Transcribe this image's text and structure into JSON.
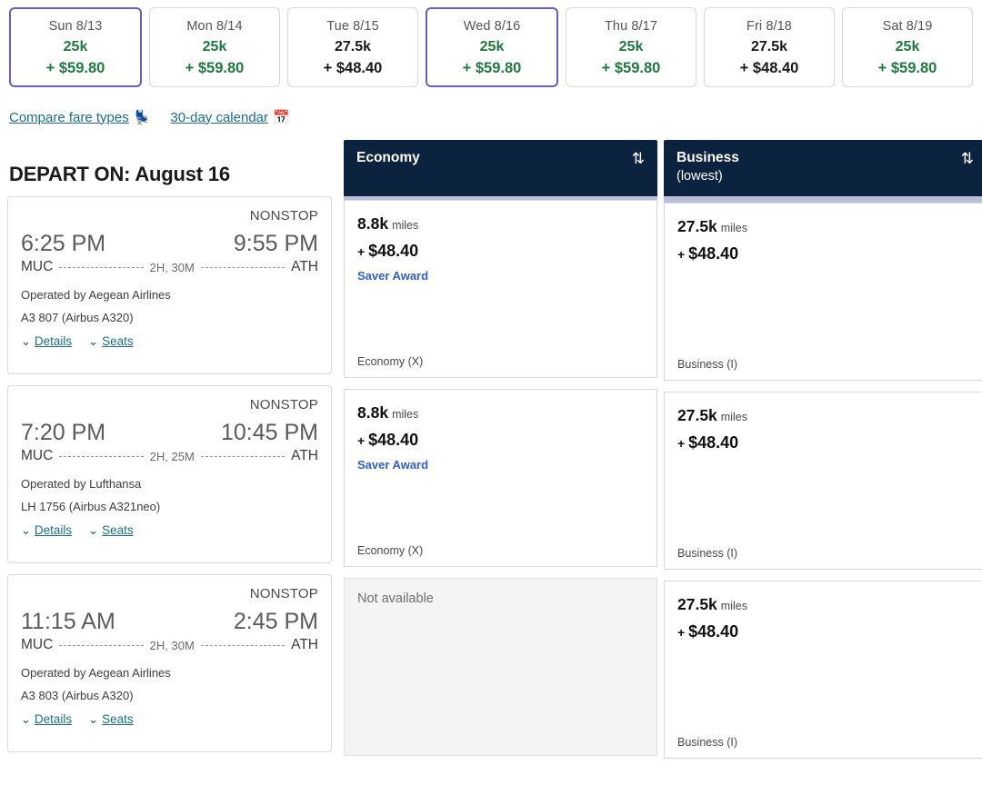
{
  "date_strip": {
    "tabs": [
      {
        "day": "Sun 8/13",
        "miles": "25k",
        "cash": "+ $59.80",
        "best": true,
        "selected": true
      },
      {
        "day": "Mon 8/14",
        "miles": "25k",
        "cash": "+ $59.80",
        "best": true,
        "selected": false
      },
      {
        "day": "Tue 8/15",
        "miles": "27.5k",
        "cash": "+ $48.40",
        "best": false,
        "selected": false
      },
      {
        "day": "Wed 8/16",
        "miles": "25k",
        "cash": "+ $59.80",
        "best": true,
        "selected": true
      },
      {
        "day": "Thu 8/17",
        "miles": "25k",
        "cash": "+ $59.80",
        "best": true,
        "selected": false
      },
      {
        "day": "Fri 8/18",
        "miles": "27.5k",
        "cash": "+ $48.40",
        "best": false,
        "selected": false
      },
      {
        "day": "Sat 8/19",
        "miles": "25k",
        "cash": "+ $59.80",
        "best": true,
        "selected": false
      }
    ]
  },
  "util_links": [
    {
      "label": "Compare fare types",
      "icon": "seat-icon",
      "glyph": "💺"
    },
    {
      "label": "30-day calendar",
      "icon": "calendar-icon",
      "glyph": "📅"
    }
  ],
  "depart_title": "DEPART ON: August 16",
  "fare_columns": [
    {
      "label": "Economy",
      "sublabel": "",
      "sort_icon": "sort-icon",
      "sort_glyph": "⇅",
      "accent_thick": false
    },
    {
      "label": "Business",
      "sublabel": "(lowest)",
      "sort_icon": "sort-icon",
      "sort_glyph": "⇅",
      "accent_thick": true
    }
  ],
  "flights": [
    {
      "stops": "NONSTOP",
      "depart_time": "6:25 PM",
      "arrive_time": "9:55 PM",
      "origin": "MUC",
      "destination": "ATH",
      "duration": "2H, 30M",
      "operated_by": "Operated by Aegean Airlines",
      "flight_number": "A3 807 (Airbus A320)",
      "details_label": "Details",
      "seats_label": "Seats",
      "economy": {
        "available": true,
        "miles": "8.8k",
        "miles_unit": "miles",
        "cash": "$48.40",
        "plus": "+",
        "award": "Saver Award",
        "fare_class": "Economy (X)"
      },
      "business": {
        "available": true,
        "miles": "27.5k",
        "miles_unit": "miles",
        "cash": "$48.40",
        "plus": "+",
        "award": "",
        "fare_class": "Business (I)"
      }
    },
    {
      "stops": "NONSTOP",
      "depart_time": "7:20 PM",
      "arrive_time": "10:45 PM",
      "origin": "MUC",
      "destination": "ATH",
      "duration": "2H, 25M",
      "operated_by": "Operated by Lufthansa",
      "flight_number": "LH 1756 (Airbus A321neo)",
      "details_label": "Details",
      "seats_label": "Seats",
      "economy": {
        "available": true,
        "miles": "8.8k",
        "miles_unit": "miles",
        "cash": "$48.40",
        "plus": "+",
        "award": "Saver Award",
        "fare_class": "Economy (X)"
      },
      "business": {
        "available": true,
        "miles": "27.5k",
        "miles_unit": "miles",
        "cash": "$48.40",
        "plus": "+",
        "award": "",
        "fare_class": "Business (I)"
      }
    },
    {
      "stops": "NONSTOP",
      "depart_time": "11:15 AM",
      "arrive_time": "2:45 PM",
      "origin": "MUC",
      "destination": "ATH",
      "duration": "2H, 30M",
      "operated_by": "Operated by Aegean Airlines",
      "flight_number": "A3 803 (Airbus A320)",
      "details_label": "Details",
      "seats_label": "Seats",
      "economy": {
        "available": false,
        "unavailable_text": "Not available"
      },
      "business": {
        "available": true,
        "miles": "27.5k",
        "miles_unit": "miles",
        "cash": "$48.40",
        "plus": "+",
        "award": "",
        "fare_class": "Business (I)"
      }
    }
  ],
  "colors": {
    "header_navy": "#0c2340",
    "accent_lavender": "#b9bedd",
    "selected_purple": "#6b5bc4",
    "best_price_green": "#1f7a3d",
    "link_blue": "#1c6e8c",
    "award_blue": "#2f5fd0"
  }
}
